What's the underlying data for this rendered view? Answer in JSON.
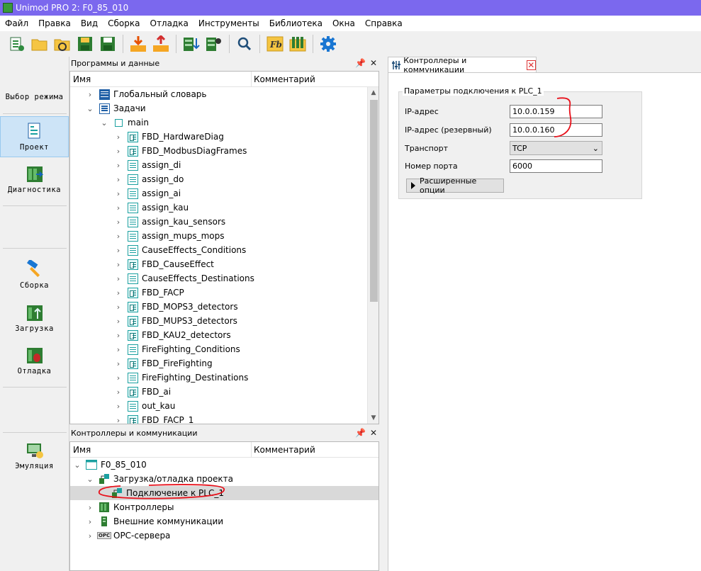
{
  "window": {
    "title": "Unimod PRO 2: F0_85_010"
  },
  "menu": [
    "Файл",
    "Правка",
    "Вид",
    "Сборка",
    "Отладка",
    "Инструменты",
    "Библиотека",
    "Окна",
    "Справка"
  ],
  "toolbar": {
    "icons": [
      "new-project-icon",
      "open-folder-icon",
      "undo-history-icon",
      "save-icon",
      "save-all-icon",
      "download-icon",
      "upload-icon",
      "build-icon",
      "settings-build-icon",
      "search-icon",
      "fb-icon",
      "library-icon",
      "gear-icon"
    ],
    "fb_text": "Fb"
  },
  "leftnav": {
    "mode_select": "Выбор режима",
    "project": "Проект",
    "diagnostics": "Диагностика",
    "build": "Сборка",
    "load": "Загрузка",
    "debug": "Отладка",
    "emulation": "Эмуляция"
  },
  "programs_panel": {
    "title": "Программы и данные",
    "col_name": "Имя",
    "col_comment": "Комментарий",
    "global_dict": "Глобальный словарь",
    "tasks": "Задачи",
    "main": "main",
    "items": [
      {
        "label": "FBD_HardwareDiag",
        "type": "fbd"
      },
      {
        "label": "FBD_ModbusDiagFrames",
        "type": "fbd"
      },
      {
        "label": "assign_di",
        "type": "doc"
      },
      {
        "label": "assign_do",
        "type": "doc"
      },
      {
        "label": "assign_ai",
        "type": "doc"
      },
      {
        "label": "assign_kau",
        "type": "doc"
      },
      {
        "label": "assign_kau_sensors",
        "type": "doc"
      },
      {
        "label": "assign_mups_mops",
        "type": "doc"
      },
      {
        "label": "CauseEffects_Conditions",
        "type": "doc"
      },
      {
        "label": "FBD_CauseEffect",
        "type": "fbd"
      },
      {
        "label": "CauseEffects_Destinations",
        "type": "doc"
      },
      {
        "label": "FBD_FACP",
        "type": "fbd"
      },
      {
        "label": "FBD_MOPS3_detectors",
        "type": "fbd"
      },
      {
        "label": "FBD_MUPS3_detectors",
        "type": "fbd"
      },
      {
        "label": "FBD_KAU2_detectors",
        "type": "fbd"
      },
      {
        "label": "FireFighting_Conditions",
        "type": "doc"
      },
      {
        "label": "FBD_FireFighting",
        "type": "fbd"
      },
      {
        "label": "FireFighting_Destinations",
        "type": "doc"
      },
      {
        "label": "FBD_ai",
        "type": "fbd"
      },
      {
        "label": "out_kau",
        "type": "doc"
      },
      {
        "label": "FBD_FACP_1",
        "type": "fbd"
      }
    ]
  },
  "controllers_panel": {
    "title": "Контроллеры и коммуникации",
    "col_name": "Имя",
    "col_comment": "Комментарий",
    "root": "F0_85_010",
    "load_debug": "Загрузка/отладка проекта",
    "connection": "Подключение к PLC_1",
    "controllers": "Контроллеры",
    "external": "Внешние коммуникации",
    "opc": "OPC-сервера",
    "opc_badge": "OPC"
  },
  "editor": {
    "tab_label": "Контроллеры и коммуникации",
    "tab_close": "✕",
    "group_title": "Параметры подключения к PLC_1",
    "ip_label": "IP-адрес",
    "ip_value": "10.0.0.159",
    "ip_backup_label": "IP-адрес (резервный)",
    "ip_backup_value": "10.0.0.160",
    "transport_label": "Транспорт",
    "transport_value": "TCP",
    "port_label": "Номер порта",
    "port_value": "6000",
    "advanced_button": "Расширенные опции"
  },
  "colors": {
    "titlebar": "#7b68ee",
    "annotation": "#e8101a",
    "icon_teal": "#1aa0a0",
    "icon_green": "#2e8b3e"
  }
}
